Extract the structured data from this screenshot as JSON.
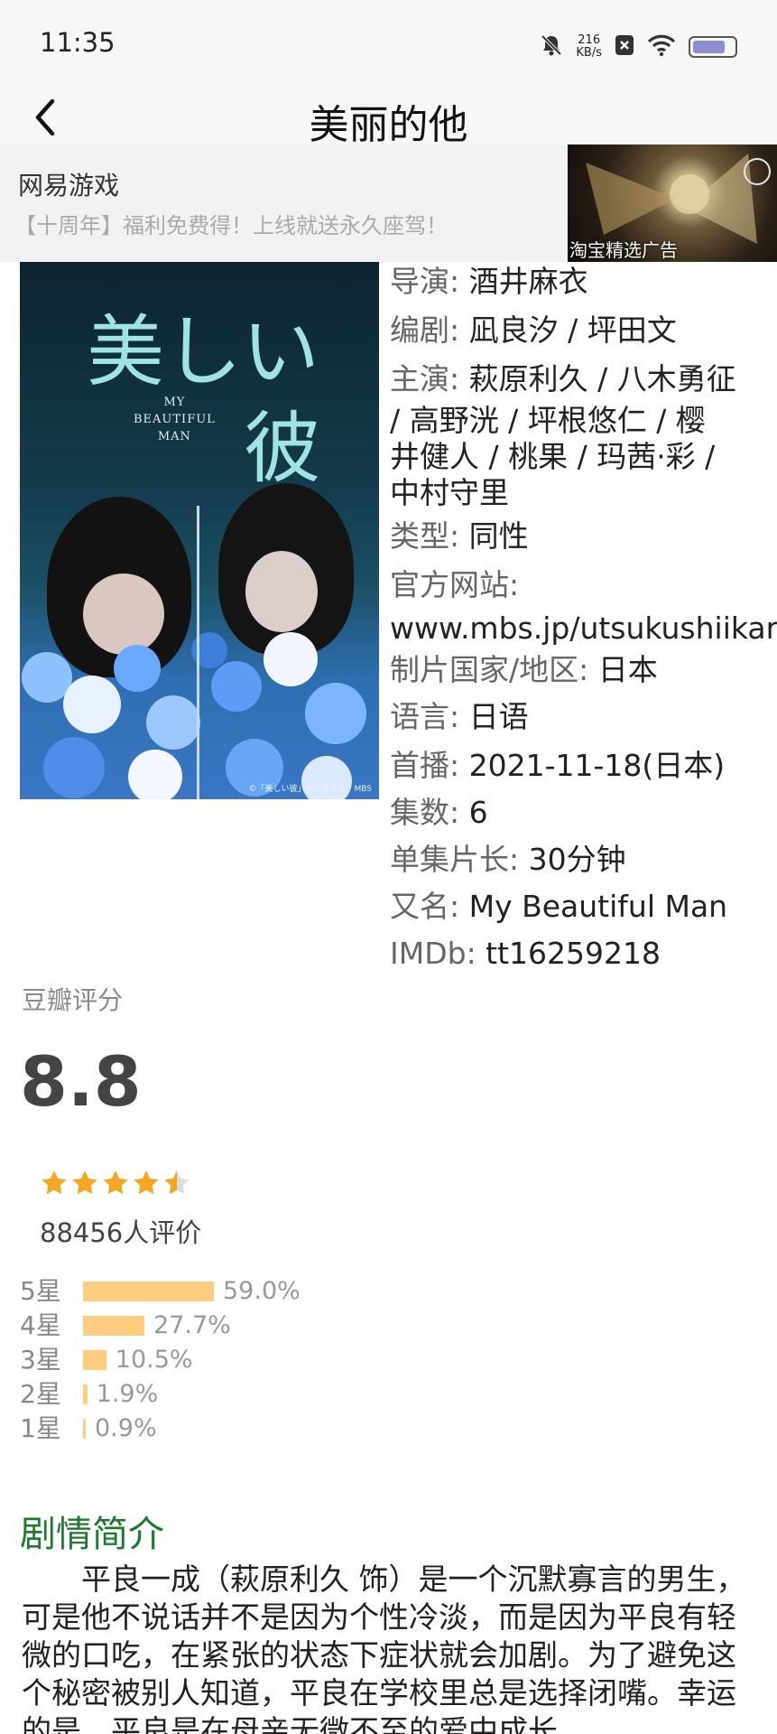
{
  "status_bar": {
    "time": "11:35",
    "net_speed_value": "216",
    "net_speed_unit": "KB/s",
    "battery_level": 0.75
  },
  "nav": {
    "title": "美丽的他"
  },
  "ad": {
    "title": "网易游戏",
    "subtitle": "【十周年】福利免费得！上线就送永久座驾！",
    "label": "淘宝精选广告"
  },
  "poster": {
    "jp_title_line1": "美しい",
    "jp_title_line2": "彼",
    "en_line1": "MY",
    "en_line2": "BEAUTIFUL",
    "en_line3": "MAN",
    "copyright": "©「美しい彼」製作委員会・MBS"
  },
  "info": {
    "director_label": "导演",
    "director": "酒井麻衣",
    "writer_label": "编剧",
    "writer": "凪良汐 / 坪田文",
    "cast_label": "主演",
    "cast_lines": [
      "萩原利久 / 八木勇征",
      "/ 高野洸 / 坪根悠仁 / 樱",
      "井健人 / 桃果 / 玛茜·彩 /",
      "中村守里"
    ],
    "genre_label": "类型",
    "genre": "同性",
    "website_label": "官方网站",
    "website": "www.mbs.jp/utsukushiikare",
    "country_label": "制片国家/地区",
    "country": "日本",
    "language_label": "语言",
    "language": "日语",
    "premiere_label": "首播",
    "premiere": "2021-11-18(日本)",
    "episodes_label": "集数",
    "episodes": "6",
    "runtime_label": "单集片长",
    "runtime": "30分钟",
    "aka_label": "又名",
    "aka": "My Beautiful Man",
    "imdb_label": "IMDb",
    "imdb": "tt16259218"
  },
  "rating": {
    "label": "豆瓣评分",
    "score": "8.8",
    "stars_value": 4.5,
    "count": "88456人评价",
    "star_color": "#f5a623",
    "bar_color": "#ffcc80",
    "distribution": [
      {
        "star": "5星",
        "pct": "59.0%",
        "value": 59.0
      },
      {
        "star": "4星",
        "pct": "27.7%",
        "value": 27.7
      },
      {
        "star": "3星",
        "pct": "10.5%",
        "value": 10.5
      },
      {
        "star": "2星",
        "pct": "1.9%",
        "value": 1.9
      },
      {
        "star": "1星",
        "pct": "0.9%",
        "value": 0.9
      }
    ]
  },
  "synopsis": {
    "title": "剧情简介",
    "text": "平良一成（萩原利久 饰）是一个沉默寡言的男生，可是他不说话并不是因为个性冷淡，而是因为平良有轻微的口吃，在紧张的状态下症状就会加剧。为了避免这个秘密被别人知道，平良在学校里总是选择闭嘴。幸运的是，平良是在母亲无微不至的爱中成长"
  }
}
